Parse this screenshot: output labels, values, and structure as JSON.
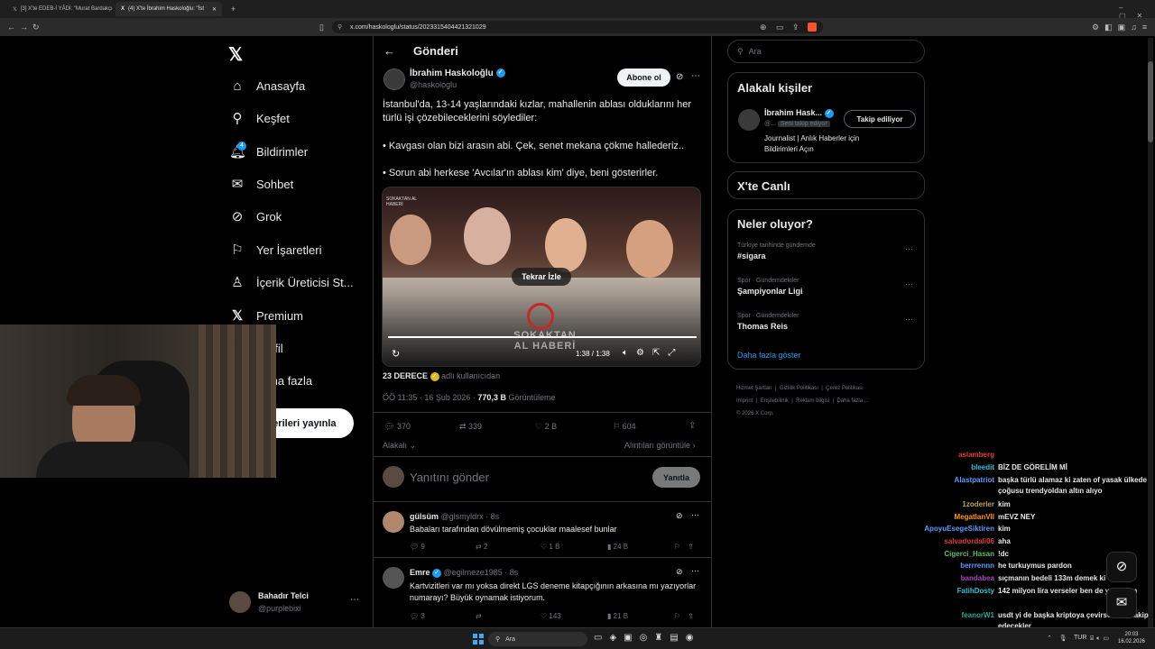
{
  "browser": {
    "tabs": [
      {
        "label": "[3] X'te EDEB-İ YÂDİ: \"Murat Bardakçı"
      },
      {
        "label": "(4) X'te İbrahim Haskoloğlu: \"İst"
      }
    ],
    "url": "x.com/haskologlu/status/2023315404421321029"
  },
  "nav": {
    "items": [
      {
        "label": "Anasayfa",
        "icon": "home-icon"
      },
      {
        "label": "Keşfet",
        "icon": "search-icon"
      },
      {
        "label": "Bildirimler",
        "icon": "bell-icon",
        "badge": "4"
      },
      {
        "label": "Sohbet",
        "icon": "mail-icon"
      },
      {
        "label": "Grok",
        "icon": "grok-icon"
      },
      {
        "label": "Yer İşaretleri",
        "icon": "bookmark-icon"
      },
      {
        "label": "İçerik Üreticisi St...",
        "icon": "creator-icon"
      },
      {
        "label": "Premium",
        "icon": "x-icon"
      },
      {
        "label": "Profil",
        "icon": "user-icon"
      },
      {
        "label": "Daha fazla",
        "icon": "more-icon"
      }
    ],
    "post_button": "Gönderileri yayınla",
    "profile": {
      "name": "Bahadır Telci",
      "handle": "@purplebixi"
    }
  },
  "post": {
    "header": "Gönderi",
    "author": "İbrahim Haskoloğlu",
    "handle": "@haskologlu",
    "subscribe": "Abone ol",
    "text": [
      "İstanbul'da, 13-14 yaşlarındaki kızlar, mahallenin ablası olduklarını her türlü işi çözebileceklerini söylediler:",
      "• Kavgası olan bizi arasın abi. Çek, senet mekana çökme hallederiz..",
      "• Sorun abi herkese 'Avcılar'ın ablası kim' diye, beni gösterirler."
    ],
    "video": {
      "replay": "Tekrar İzle",
      "time": "1:38 / 1:38",
      "watermark": "SOKAKTAN AL HABERİ",
      "watermark_small": "SOKAKTAN AL HABERİ",
      "progress": 1.0
    },
    "source_name": "23 DERECE",
    "source_sub": "adlı kullanıcıdan",
    "time": "ÖÖ 11:35 · 16 Şub 2026 ·",
    "views": "770,3 B",
    "views_label": "Görüntüleme",
    "stats": {
      "replies": "370",
      "reposts": "339",
      "likes": "2 B",
      "bookmarks": "604"
    },
    "relevant": "Alakalı",
    "quotes": "Alıntıları görüntüle",
    "reply_placeholder": "Yanıtını gönder",
    "reply_button": "Yanıtla"
  },
  "replies": [
    {
      "name": "gülsüm",
      "handle": "@glsmyldrx · 8s",
      "text": "Babaları tarafından dövülmemiş çocuklar maalesef bunlar",
      "stats": [
        "9",
        "2",
        "1 B",
        "24 B"
      ]
    },
    {
      "name": "Emre",
      "handle": "@egilmeze1985 · 8s",
      "text": "Kartvizitleri var mı yoksa direkt LGS deneme kitapçığının arkasına mı yazıyorlar numarayı? Büyük oynamak istiyorum.",
      "stats": [
        "3",
        "",
        "143",
        "21 B"
      ]
    }
  ],
  "sidebar": {
    "search_placeholder": "Ara",
    "related_title": "Alakalı kişiler",
    "related_name": "İbrahim Hask...",
    "related_handle": "@...",
    "related_follows": "Seni takip ediyor",
    "related_button": "Takip ediliyor",
    "related_bio": "Journalist | Anlık Haberler için Bildirimleri Açın",
    "live_title": "X'te Canlı",
    "trends_title": "Neler oluyor?",
    "trends": [
      {
        "category": "Türkiye tarihinde gündemde",
        "name": "#sigara"
      },
      {
        "category": "Spor · Gündemdekiler",
        "name": "Şampiyonlar Ligi"
      },
      {
        "category": "Spor · Gündemdekiler",
        "name": "Thomas Reis"
      }
    ],
    "show_more": "Daha fazla göster",
    "footer": [
      "Hizmet Şartları",
      "Gizlilik Politikası",
      "Çerez Politikası",
      "Imprint",
      "Erişilebilirlik",
      "Reklam bilgisi",
      "Daha fazla ...",
      "© 2026 X Corp."
    ]
  },
  "chat": [
    {
      "user": "aslamberg",
      "msg": "",
      "color": "#e53935"
    },
    {
      "user": "bleedit",
      "msg": "BİZ DE GÖRELİM Mİ",
      "color": "#26c6da"
    },
    {
      "user": "Alastpatriot",
      "msg": "başka türlü alamaz ki zaten of yasak ülkede çoğusu trendyoldan altın alıyo",
      "color": "#5c9cff"
    },
    {
      "user": "1zoderler",
      "msg": "kim",
      "color": "#c0a060"
    },
    {
      "user": "MegatlanVII",
      "msg": "mEVZ NEY",
      "color": "#ff9800"
    },
    {
      "user": "ApoyuEsegeSiktiren",
      "msg": "kim",
      "color": "#5c9cff"
    },
    {
      "user": "salvadordali06",
      "msg": "aha",
      "color": "#e53935"
    },
    {
      "user": "Cigerci_Hasan",
      "msg": "!dc",
      "color": "#66bb6a"
    },
    {
      "user": "berrrennn",
      "msg": "he turkuymus pardon",
      "color": "#5c9cff"
    },
    {
      "user": "bandabea",
      "msg": "sıçmanın bedeli 133m demek ki",
      "color": "#ab47bc"
    },
    {
      "user": "FatihDosty",
      "msg": "142 milyon lira verseler ben de yapardım",
      "color": "#26c6da"
    },
    {
      "user": "feanorW1",
      "msg": "usdt yi de başka kriptoya çevirse nasıl takip edecekler",
      "color": "#26a69a"
    },
    {
      "user": "salvadordali06",
      "msg": "",
      "color": "#e53935"
    }
  ],
  "taskbar": {
    "search": "Ara",
    "lang": "TUR",
    "time": "20:03",
    "date": "16.02.2026"
  }
}
